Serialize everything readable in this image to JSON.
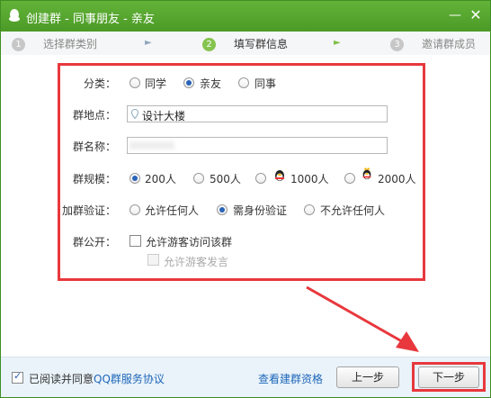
{
  "window": {
    "title": "创建群 - 同事朋友 - 亲友",
    "minimize": "—",
    "close": "✕"
  },
  "steps": [
    {
      "num": "1",
      "label": "选择群类别"
    },
    {
      "num": "2",
      "label": "填写群信息"
    },
    {
      "num": "3",
      "label": "邀请群成员"
    }
  ],
  "step_arrow": "►",
  "form": {
    "category": {
      "label": "分类：",
      "options": [
        "同学",
        "亲友",
        "同事"
      ],
      "selected": "亲友"
    },
    "location": {
      "label": "群地点：",
      "value": "设计大楼"
    },
    "name": {
      "label": "群名称：",
      "value": ""
    },
    "size": {
      "label": "群规模：",
      "options": [
        "200人",
        "500人",
        "1000人",
        "2000人"
      ],
      "selected": "200人"
    },
    "verify": {
      "label": "加群验证：",
      "options": [
        "允许任何人",
        "需身份验证",
        "不允许任何人"
      ],
      "selected": "需身份验证"
    },
    "public": {
      "label": "群公开：",
      "visitor_label": "允许游客访问该群",
      "visitor_checked": false,
      "post_label": "允许游客发言",
      "post_checked": false
    }
  },
  "bottom": {
    "agree_text": "已阅读并同意",
    "agree_link": "QQ群服务协议",
    "agree_checked": true,
    "view_link": "查看建群资格",
    "prev_button": "上一步",
    "next_button": "下一步"
  },
  "colors": {
    "title_bar": "#4b9a27",
    "highlight": "#e8383d",
    "link": "#1f67b9"
  }
}
